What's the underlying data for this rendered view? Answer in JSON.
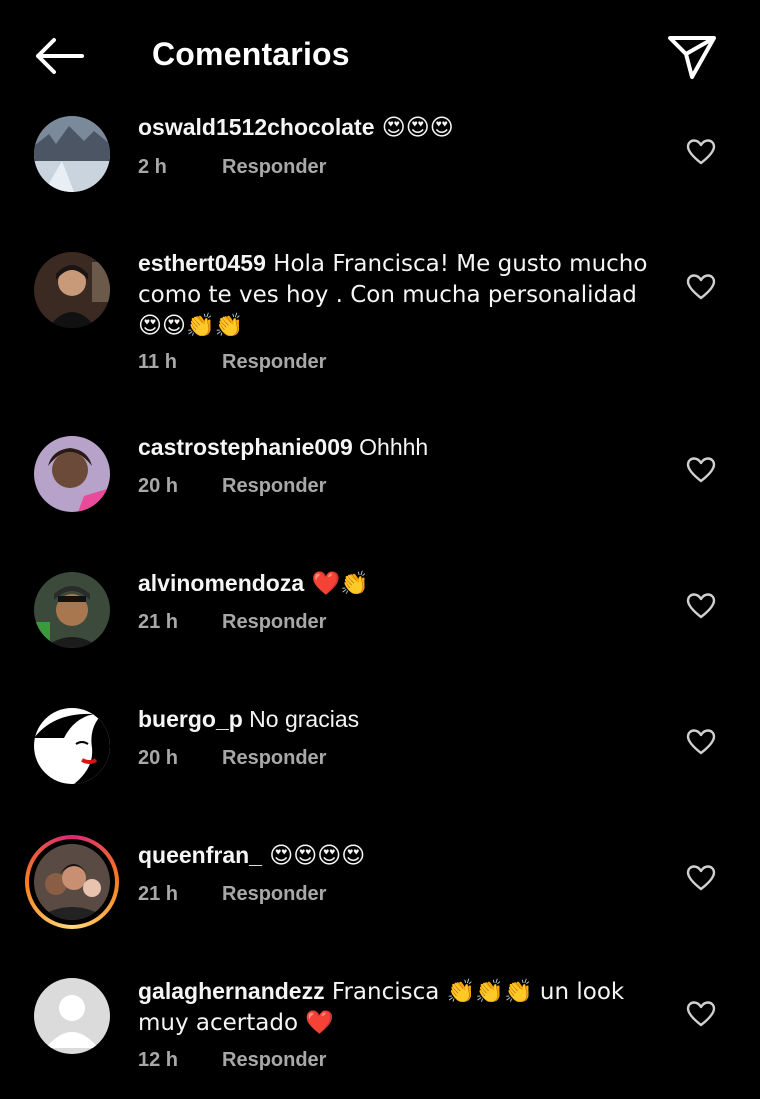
{
  "header": {
    "title": "Comentarios"
  },
  "comments": [
    {
      "username": "oswald1512chocolate",
      "text": " 😍😍😍",
      "time": "2 h",
      "reply": "Responder"
    },
    {
      "username": "esthert0459",
      "text": " Hola Francisca! Me gusto mucho como te ves hoy . Con mucha personalidad 😍😍👏👏",
      "time": "11 h",
      "reply": "Responder"
    },
    {
      "username": "castrostephanie009",
      "text": " Ohhhh",
      "time": "20 h",
      "reply": "Responder"
    },
    {
      "username": "alvinomendoza",
      "text": " ❤️👏",
      "time": "21 h",
      "reply": "Responder"
    },
    {
      "username": "buergo_p",
      "text": " No gracias",
      "time": "20 h",
      "reply": "Responder"
    },
    {
      "username": "queenfran_",
      "text": " 😍😍😍😍",
      "time": "21 h",
      "reply": "Responder"
    },
    {
      "username": "galaghernandezz",
      "text": " Francisca 👏👏👏 un look muy acertado ❤️",
      "time": "12 h",
      "reply": "Responder"
    }
  ],
  "colors": {
    "background": "#000000",
    "text": "#f5f5f5",
    "meta": "#a8a8a8"
  },
  "icons": {
    "back": "arrow-left-icon",
    "send": "paper-plane-icon",
    "like": "heart-outline-icon"
  }
}
